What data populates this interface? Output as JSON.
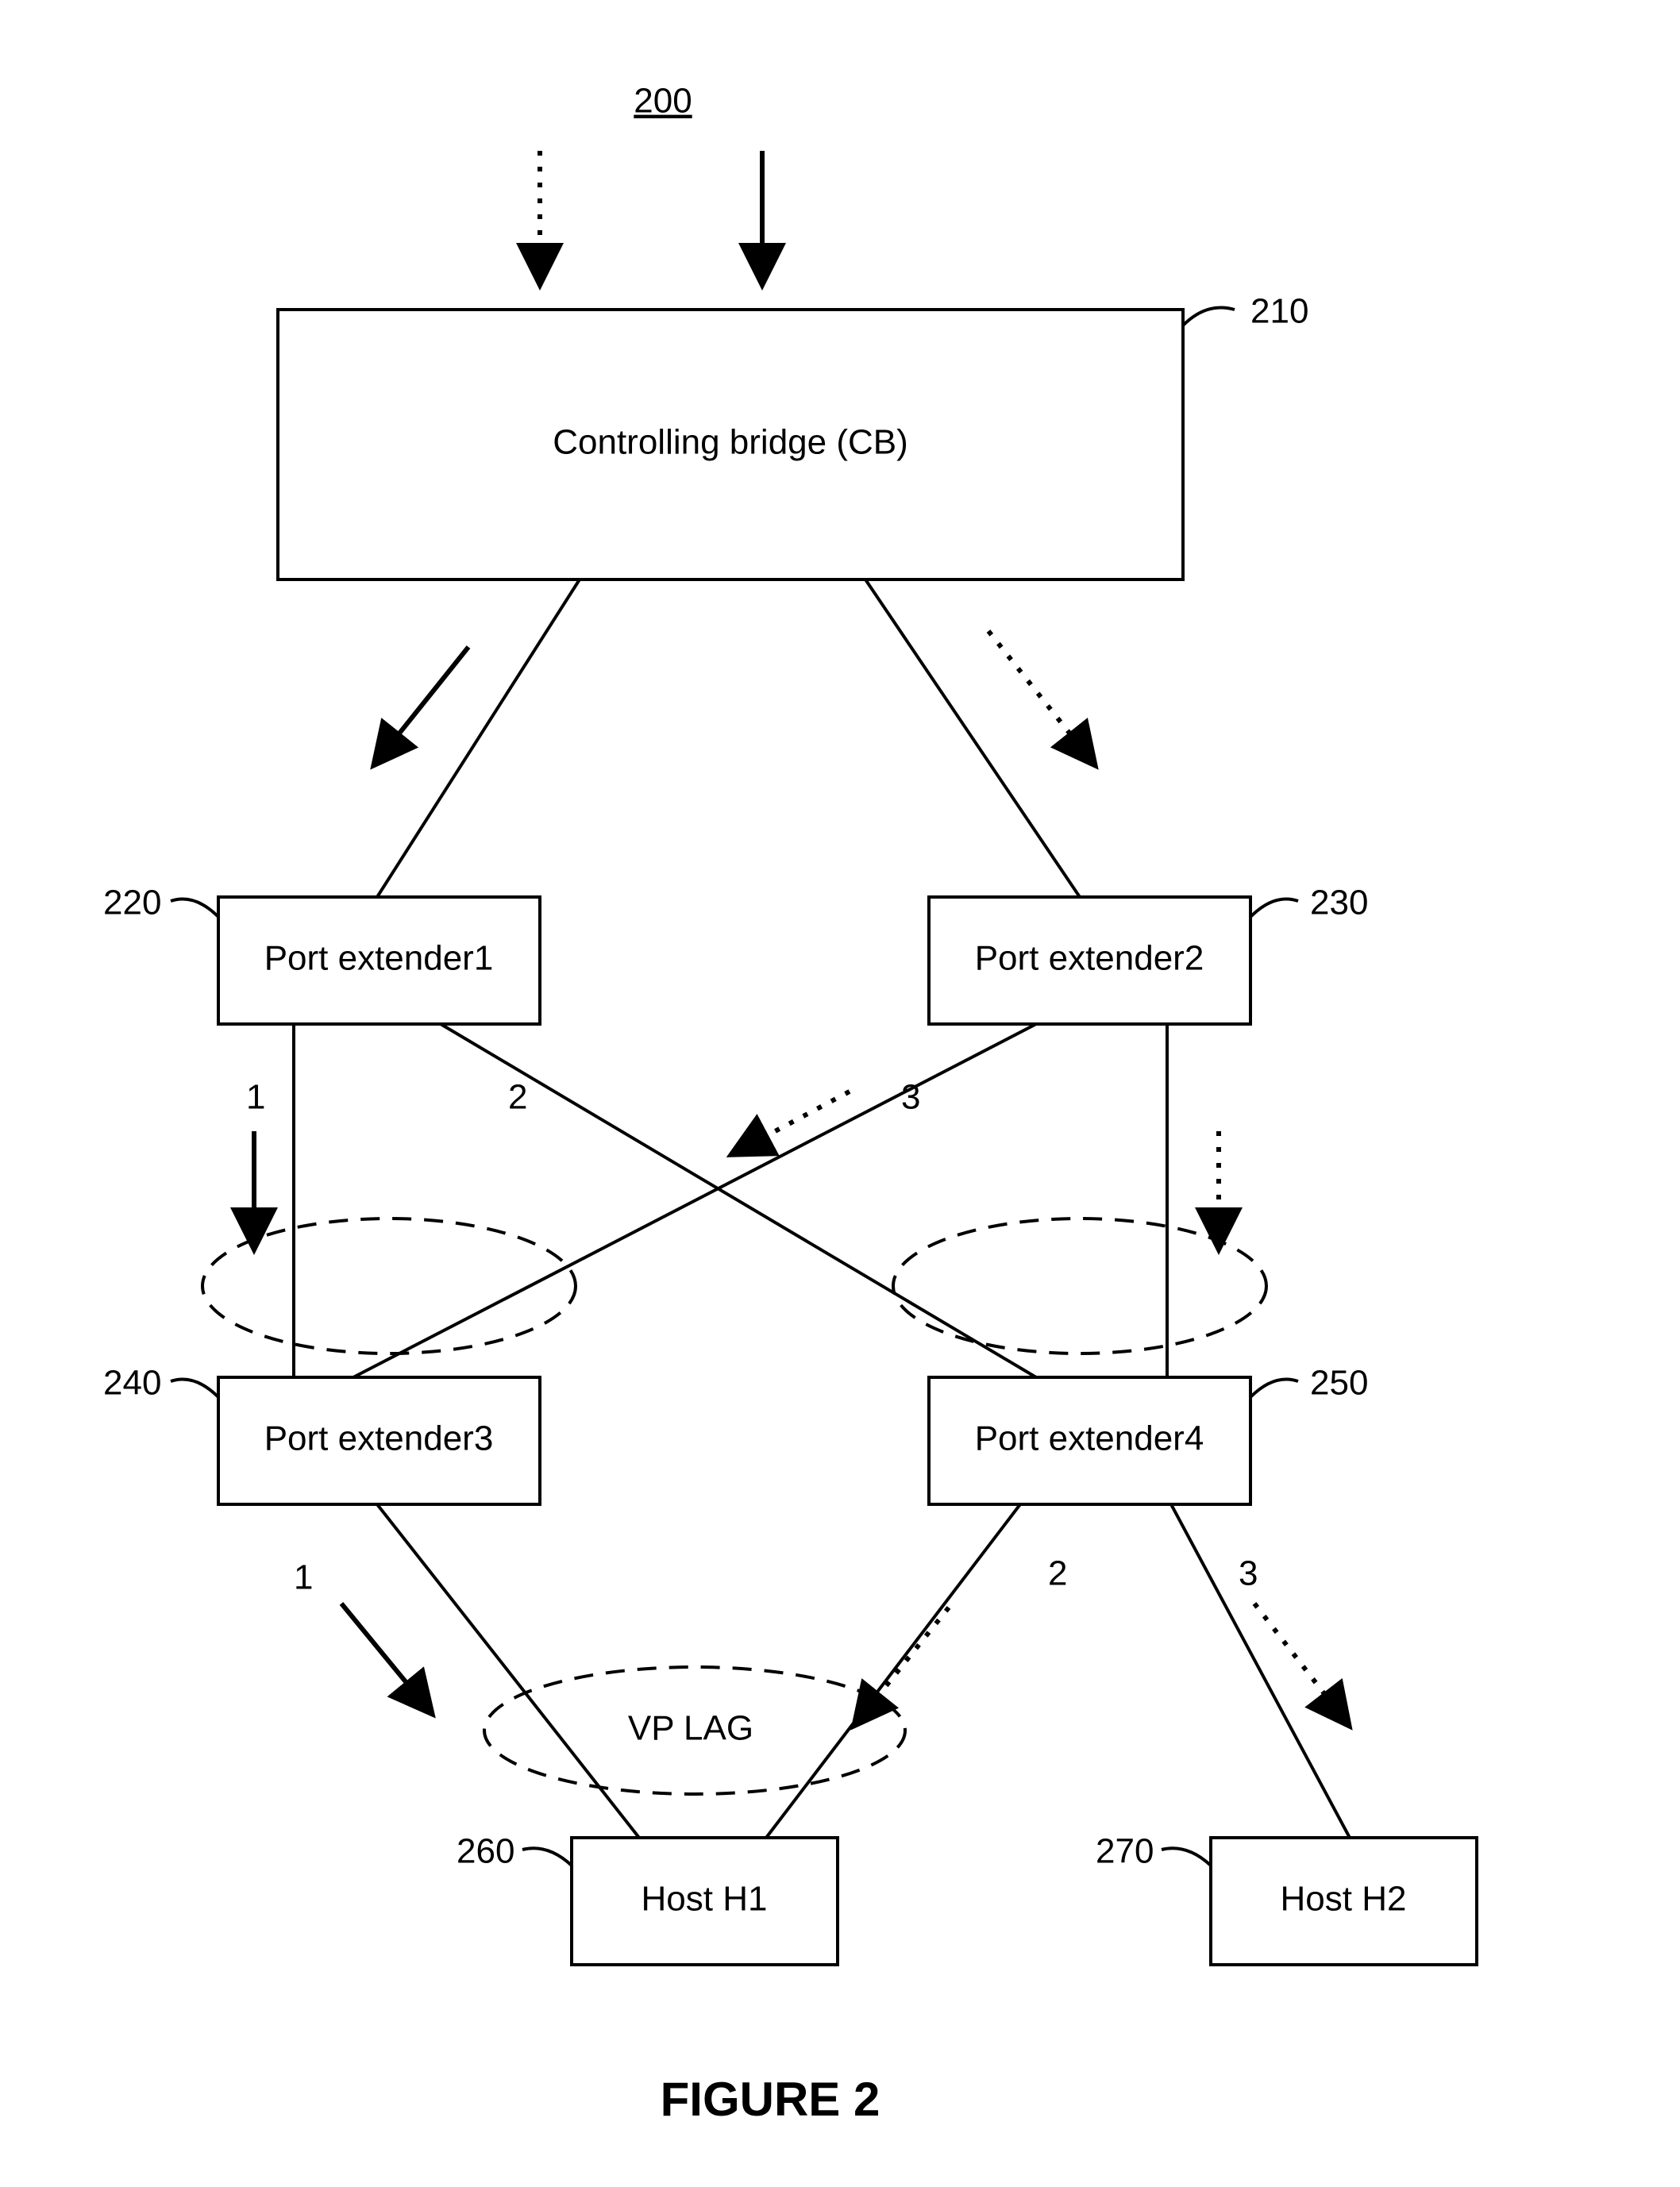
{
  "chart_data": {
    "type": "diagram",
    "figure_ref": "200",
    "figure_title": "FIGURE 2",
    "nodes": [
      {
        "id": "CB",
        "label": "Controlling bridge (CB)",
        "ref": "210"
      },
      {
        "id": "PE1",
        "label": "Port extender1",
        "ref": "220"
      },
      {
        "id": "PE2",
        "label": "Port extender2",
        "ref": "230"
      },
      {
        "id": "PE3",
        "label": "Port extender3",
        "ref": "240"
      },
      {
        "id": "PE4",
        "label": "Port extender4",
        "ref": "250"
      },
      {
        "id": "H1",
        "label": "Host H1",
        "ref": "260"
      },
      {
        "id": "H2",
        "label": "Host H2",
        "ref": "270"
      }
    ],
    "edges": [
      {
        "from": "CB",
        "to": "PE1",
        "style": "solid"
      },
      {
        "from": "CB",
        "to": "PE2",
        "style": "dotted"
      },
      {
        "from": "PE1",
        "to": "PE3",
        "style": "solid",
        "port_label": "1"
      },
      {
        "from": "PE1",
        "to": "PE4",
        "style": "solid",
        "port_label": "2"
      },
      {
        "from": "PE2",
        "to": "PE3",
        "style": "dotted",
        "port_label": "3"
      },
      {
        "from": "PE2",
        "to": "PE4",
        "style": "dotted"
      },
      {
        "from": "PE3",
        "to": "H1",
        "style": "solid",
        "port_label": "1"
      },
      {
        "from": "PE4",
        "to": "H1",
        "style": "dotted",
        "port_label": "2"
      },
      {
        "from": "PE4",
        "to": "H2",
        "style": "dotted",
        "port_label": "3"
      }
    ],
    "groups": [
      {
        "label": "VP LAG",
        "members_edges": [
          "PE3-H1",
          "PE4-H1"
        ]
      },
      {
        "label": "",
        "members_edges": [
          "PE1-PE3",
          "PE2-PE3"
        ]
      },
      {
        "label": "",
        "members_edges": [
          "PE1-PE4",
          "PE2-PE4"
        ]
      }
    ],
    "inputs": [
      {
        "to": "CB",
        "style": "dotted"
      },
      {
        "to": "CB",
        "style": "solid"
      }
    ]
  }
}
